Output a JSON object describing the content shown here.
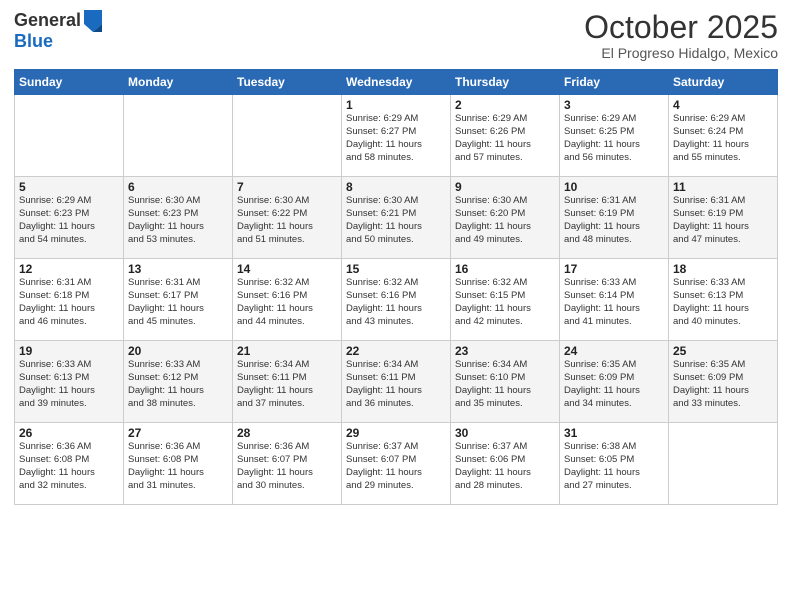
{
  "header": {
    "logo_general": "General",
    "logo_blue": "Blue",
    "month": "October 2025",
    "location": "El Progreso Hidalgo, Mexico"
  },
  "days_of_week": [
    "Sunday",
    "Monday",
    "Tuesday",
    "Wednesday",
    "Thursday",
    "Friday",
    "Saturday"
  ],
  "weeks": [
    [
      {
        "day": "",
        "info": ""
      },
      {
        "day": "",
        "info": ""
      },
      {
        "day": "",
        "info": ""
      },
      {
        "day": "1",
        "info": "Sunrise: 6:29 AM\nSunset: 6:27 PM\nDaylight: 11 hours\nand 58 minutes."
      },
      {
        "day": "2",
        "info": "Sunrise: 6:29 AM\nSunset: 6:26 PM\nDaylight: 11 hours\nand 57 minutes."
      },
      {
        "day": "3",
        "info": "Sunrise: 6:29 AM\nSunset: 6:25 PM\nDaylight: 11 hours\nand 56 minutes."
      },
      {
        "day": "4",
        "info": "Sunrise: 6:29 AM\nSunset: 6:24 PM\nDaylight: 11 hours\nand 55 minutes."
      }
    ],
    [
      {
        "day": "5",
        "info": "Sunrise: 6:29 AM\nSunset: 6:23 PM\nDaylight: 11 hours\nand 54 minutes."
      },
      {
        "day": "6",
        "info": "Sunrise: 6:30 AM\nSunset: 6:23 PM\nDaylight: 11 hours\nand 53 minutes."
      },
      {
        "day": "7",
        "info": "Sunrise: 6:30 AM\nSunset: 6:22 PM\nDaylight: 11 hours\nand 51 minutes."
      },
      {
        "day": "8",
        "info": "Sunrise: 6:30 AM\nSunset: 6:21 PM\nDaylight: 11 hours\nand 50 minutes."
      },
      {
        "day": "9",
        "info": "Sunrise: 6:30 AM\nSunset: 6:20 PM\nDaylight: 11 hours\nand 49 minutes."
      },
      {
        "day": "10",
        "info": "Sunrise: 6:31 AM\nSunset: 6:19 PM\nDaylight: 11 hours\nand 48 minutes."
      },
      {
        "day": "11",
        "info": "Sunrise: 6:31 AM\nSunset: 6:19 PM\nDaylight: 11 hours\nand 47 minutes."
      }
    ],
    [
      {
        "day": "12",
        "info": "Sunrise: 6:31 AM\nSunset: 6:18 PM\nDaylight: 11 hours\nand 46 minutes."
      },
      {
        "day": "13",
        "info": "Sunrise: 6:31 AM\nSunset: 6:17 PM\nDaylight: 11 hours\nand 45 minutes."
      },
      {
        "day": "14",
        "info": "Sunrise: 6:32 AM\nSunset: 6:16 PM\nDaylight: 11 hours\nand 44 minutes."
      },
      {
        "day": "15",
        "info": "Sunrise: 6:32 AM\nSunset: 6:16 PM\nDaylight: 11 hours\nand 43 minutes."
      },
      {
        "day": "16",
        "info": "Sunrise: 6:32 AM\nSunset: 6:15 PM\nDaylight: 11 hours\nand 42 minutes."
      },
      {
        "day": "17",
        "info": "Sunrise: 6:33 AM\nSunset: 6:14 PM\nDaylight: 11 hours\nand 41 minutes."
      },
      {
        "day": "18",
        "info": "Sunrise: 6:33 AM\nSunset: 6:13 PM\nDaylight: 11 hours\nand 40 minutes."
      }
    ],
    [
      {
        "day": "19",
        "info": "Sunrise: 6:33 AM\nSunset: 6:13 PM\nDaylight: 11 hours\nand 39 minutes."
      },
      {
        "day": "20",
        "info": "Sunrise: 6:33 AM\nSunset: 6:12 PM\nDaylight: 11 hours\nand 38 minutes."
      },
      {
        "day": "21",
        "info": "Sunrise: 6:34 AM\nSunset: 6:11 PM\nDaylight: 11 hours\nand 37 minutes."
      },
      {
        "day": "22",
        "info": "Sunrise: 6:34 AM\nSunset: 6:11 PM\nDaylight: 11 hours\nand 36 minutes."
      },
      {
        "day": "23",
        "info": "Sunrise: 6:34 AM\nSunset: 6:10 PM\nDaylight: 11 hours\nand 35 minutes."
      },
      {
        "day": "24",
        "info": "Sunrise: 6:35 AM\nSunset: 6:09 PM\nDaylight: 11 hours\nand 34 minutes."
      },
      {
        "day": "25",
        "info": "Sunrise: 6:35 AM\nSunset: 6:09 PM\nDaylight: 11 hours\nand 33 minutes."
      }
    ],
    [
      {
        "day": "26",
        "info": "Sunrise: 6:36 AM\nSunset: 6:08 PM\nDaylight: 11 hours\nand 32 minutes."
      },
      {
        "day": "27",
        "info": "Sunrise: 6:36 AM\nSunset: 6:08 PM\nDaylight: 11 hours\nand 31 minutes."
      },
      {
        "day": "28",
        "info": "Sunrise: 6:36 AM\nSunset: 6:07 PM\nDaylight: 11 hours\nand 30 minutes."
      },
      {
        "day": "29",
        "info": "Sunrise: 6:37 AM\nSunset: 6:07 PM\nDaylight: 11 hours\nand 29 minutes."
      },
      {
        "day": "30",
        "info": "Sunrise: 6:37 AM\nSunset: 6:06 PM\nDaylight: 11 hours\nand 28 minutes."
      },
      {
        "day": "31",
        "info": "Sunrise: 6:38 AM\nSunset: 6:05 PM\nDaylight: 11 hours\nand 27 minutes."
      },
      {
        "day": "",
        "info": ""
      }
    ]
  ]
}
